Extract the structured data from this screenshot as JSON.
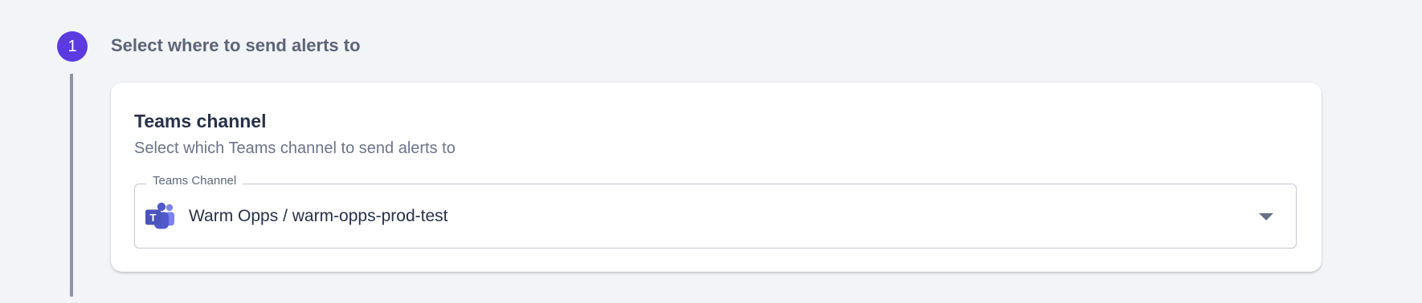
{
  "step": {
    "number": "1",
    "title": "Select where to send alerts to"
  },
  "card": {
    "title": "Teams channel",
    "subtitle": "Select which Teams channel to send alerts to",
    "field": {
      "label": "Teams Channel",
      "value": "Warm Opps / warm-opps-prod-test",
      "icon": "microsoft-teams-icon",
      "dropdown_icon": "chevron-down-icon"
    }
  },
  "colors": {
    "accent": "#5b3be0",
    "background": "#f3f4f7",
    "card": "#ffffff",
    "teams": "#5059c9"
  }
}
